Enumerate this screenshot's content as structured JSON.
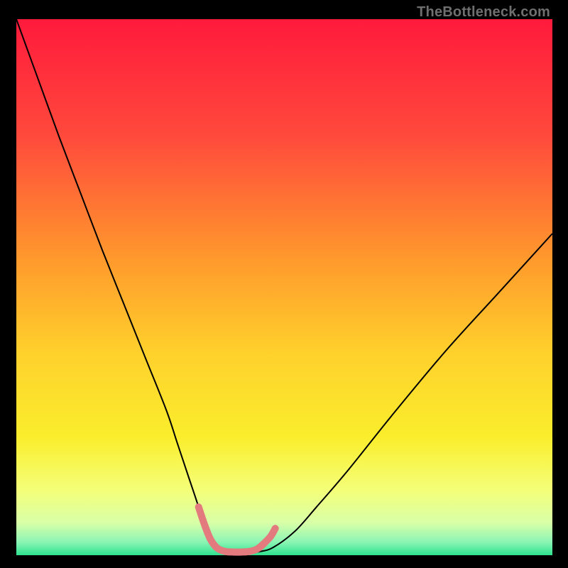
{
  "watermark": "TheBottleneck.com",
  "chart_data": {
    "type": "line",
    "title": "",
    "xlabel": "",
    "ylabel": "",
    "xlim": [
      0,
      100
    ],
    "ylim": [
      0,
      100
    ],
    "background_gradient": {
      "dir": "top-to-bottom",
      "stops": [
        {
          "pos": 0.0,
          "color": "#ff1a3c"
        },
        {
          "pos": 0.22,
          "color": "#ff4a3c"
        },
        {
          "pos": 0.45,
          "color": "#ff9a2c"
        },
        {
          "pos": 0.62,
          "color": "#ffd02c"
        },
        {
          "pos": 0.78,
          "color": "#faee2c"
        },
        {
          "pos": 0.88,
          "color": "#f4ff7a"
        },
        {
          "pos": 0.94,
          "color": "#d8ffa8"
        },
        {
          "pos": 0.975,
          "color": "#8cf5b4"
        },
        {
          "pos": 1.0,
          "color": "#2fe38f"
        }
      ]
    },
    "series": [
      {
        "name": "bottleneck-curve",
        "stroke": "#000000",
        "stroke_width": 2,
        "x": [
          0,
          4,
          8,
          12,
          16,
          20,
          24,
          28,
          30,
          32,
          34,
          35.5,
          37.5,
          40.5,
          43,
          45.5,
          48,
          52,
          56,
          62,
          70,
          80,
          90,
          100
        ],
        "y": [
          100,
          89,
          78,
          67.5,
          57,
          47,
          37,
          27,
          21,
          15,
          9,
          4,
          1.5,
          0.7,
          0.5,
          0.7,
          1.5,
          4.5,
          9,
          16,
          26,
          38,
          49,
          60
        ]
      },
      {
        "name": "valley-overlay",
        "stroke": "#e37a7e",
        "stroke_width": 10,
        "linecap": "round",
        "x": [
          34.0,
          35.0,
          36.2,
          37.5,
          39.0,
          40.5,
          42.0,
          43.5,
          45.0,
          46.2,
          47.5,
          48.3
        ],
        "y": [
          9.0,
          6.0,
          3.0,
          1.3,
          0.7,
          0.6,
          0.6,
          0.7,
          1.2,
          2.2,
          3.6,
          5.0
        ]
      }
    ]
  }
}
